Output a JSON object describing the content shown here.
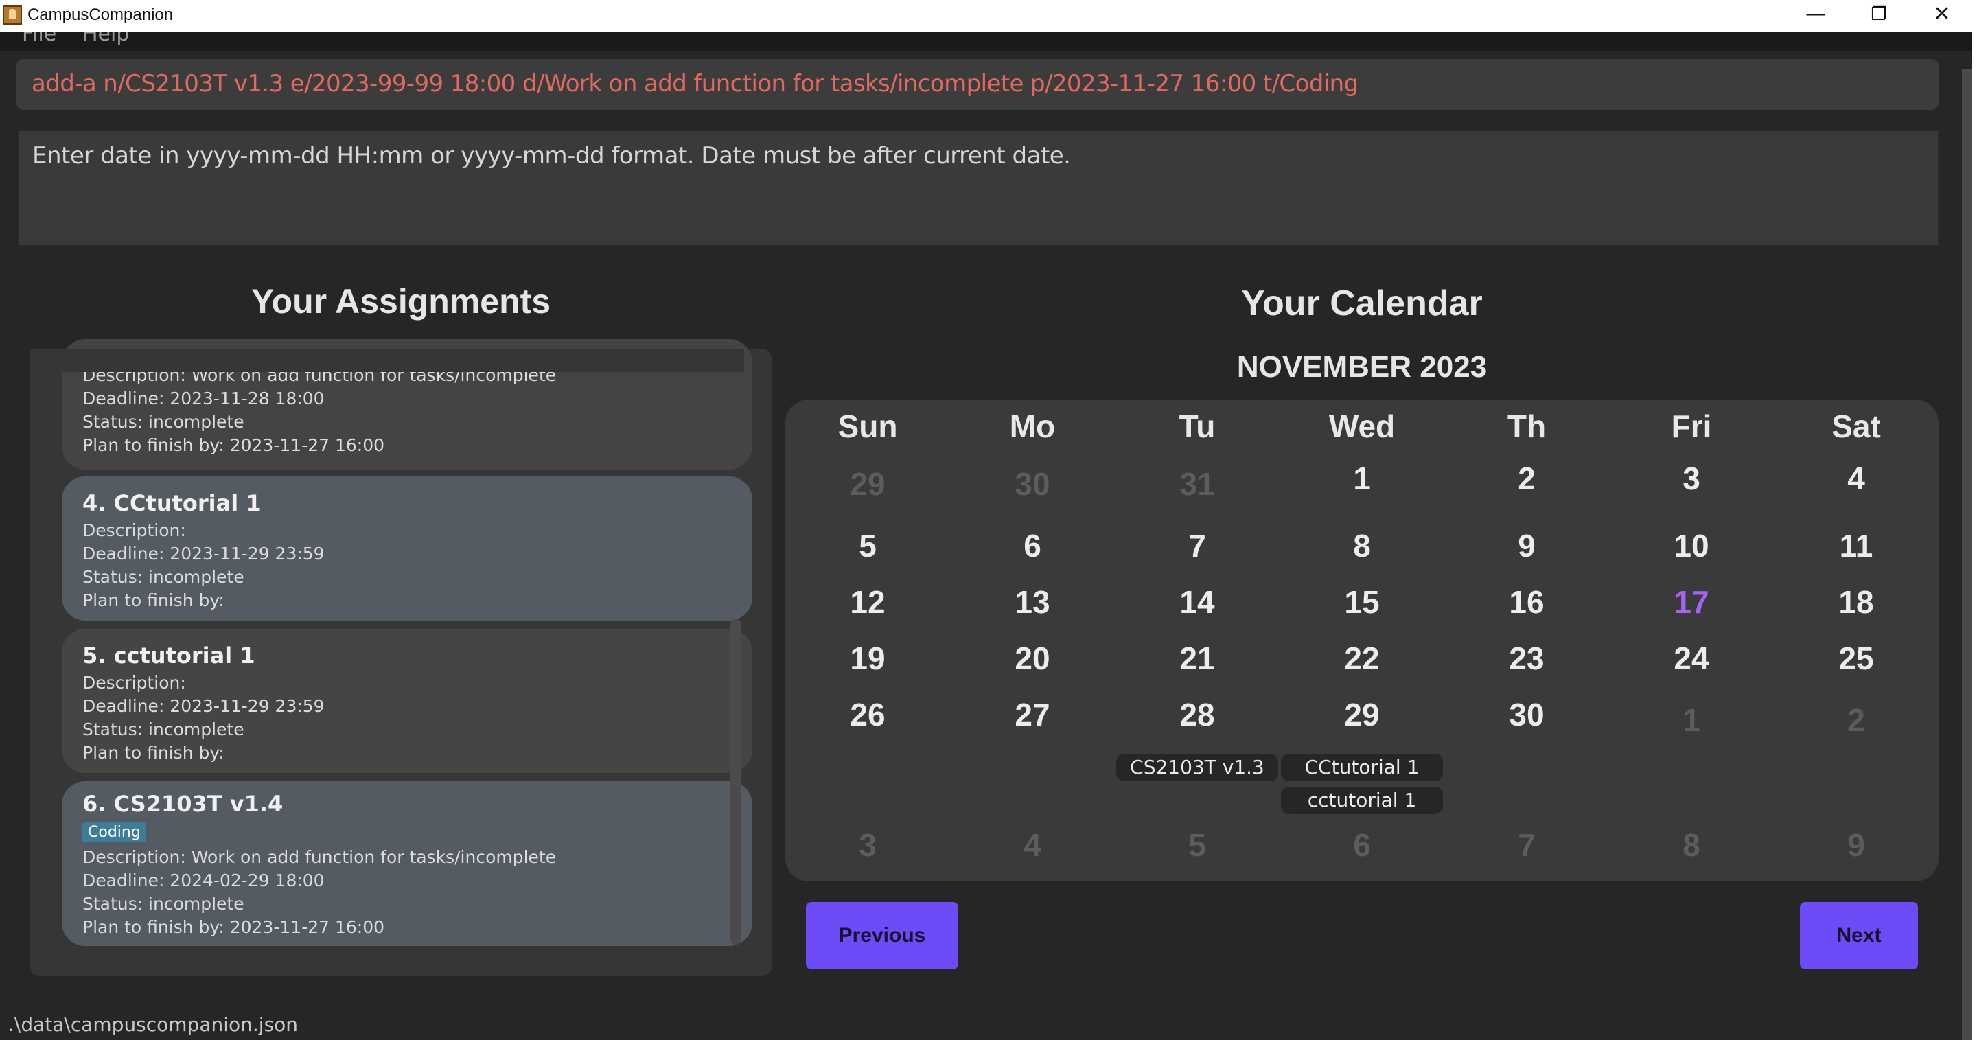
{
  "window": {
    "title": "CampusCompanion",
    "minimize": "—",
    "maximize": "❐",
    "close": "✕"
  },
  "menu": {
    "file": "File",
    "help": "Help"
  },
  "command": {
    "text": "add-a n/CS2103T v1.3 e/2023-99-99 18:00 d/Work on add function for tasks/incomplete p/2023-11-27 16:00 t/Coding",
    "color": "#e06a5f"
  },
  "result": {
    "text": "Enter date in yyyy-mm-dd HH:mm or yyyy-mm-dd format. Date must be after current date."
  },
  "assignments": {
    "title": "Your Assignments",
    "cards": [
      {
        "name": "",
        "tag": "",
        "description": "Description: Work on add function for tasks/incomplete",
        "deadline": "Deadline: 2023-11-28 18:00",
        "status": "Status: incomplete",
        "plan": "Plan to finish by: 2023-11-27 16:00"
      },
      {
        "name": "4.  CCtutorial 1",
        "tag": "",
        "description": "Description:",
        "deadline": "Deadline: 2023-11-29 23:59",
        "status": "Status: incomplete",
        "plan": "Plan to finish by:"
      },
      {
        "name": "5.  cctutorial 1",
        "tag": "",
        "description": "Description:",
        "deadline": "Deadline: 2023-11-29 23:59",
        "status": "Status: incomplete",
        "plan": "Plan to finish by:"
      },
      {
        "name": "6.  CS2103T v1.4",
        "tag": "Coding",
        "description": "Description: Work on add function for tasks/incomplete",
        "deadline": "Deadline: 2024-02-29 18:00",
        "status": "Status: incomplete",
        "plan": "Plan to finish by: 2023-11-27 16:00"
      }
    ]
  },
  "calendar": {
    "title": "Your Calendar",
    "month": "NOVEMBER 2023",
    "days_of_week": [
      "Sun",
      "Mo",
      "Tu",
      "Wed",
      "Th",
      "Fri",
      "Sat"
    ],
    "today": "17",
    "today_color": "#a463f2",
    "weeks": [
      [
        "29",
        "30",
        "31",
        "1",
        "2",
        "3",
        "4"
      ],
      [
        "5",
        "6",
        "7",
        "8",
        "9",
        "10",
        "11"
      ],
      [
        "12",
        "13",
        "14",
        "15",
        "16",
        "17",
        "18"
      ],
      [
        "19",
        "20",
        "21",
        "22",
        "23",
        "24",
        "25"
      ],
      [
        "26",
        "27",
        "28",
        "29",
        "30",
        "1",
        "2"
      ],
      [
        "3",
        "4",
        "5",
        "6",
        "7",
        "8",
        "9"
      ]
    ],
    "events": {
      "tue_28": "CS2103T v1.3",
      "wed_29_a": "CCtutorial 1",
      "wed_29_b": "cctutorial 1"
    },
    "previous_label": "Previous",
    "next_label": "Next",
    "button_color": "#6d4cf7"
  },
  "status_bar": {
    "path": ".\\data\\campuscompanion.json"
  }
}
